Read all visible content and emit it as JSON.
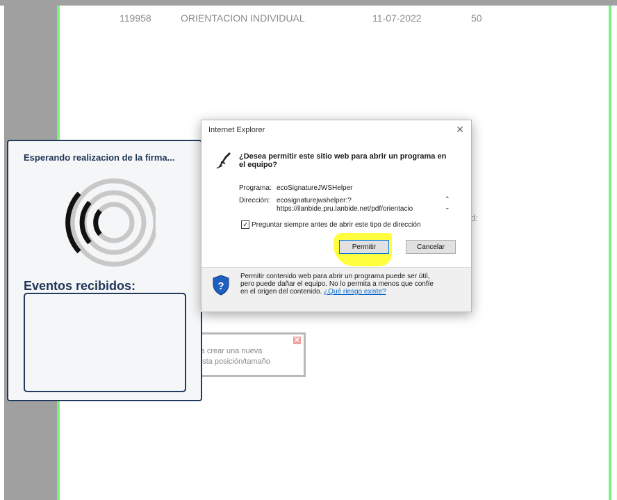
{
  "background_row": {
    "id": "119958",
    "name": "ORIENTACION INDIVIDUAL",
    "date": "11-07-2022",
    "count": "50"
  },
  "stray_text": "d:",
  "signature_popup": {
    "title": "Esperando realizacion de la firma...",
    "events_label": "Eventos recibidos:",
    "icon": "signal-waves-icon"
  },
  "hint_box": {
    "line1": "ra crear una nueva",
    "line2": "esta posición/tamaño",
    "close": "✕"
  },
  "ie_dialog": {
    "window_title": "Internet Explorer",
    "close": "✕",
    "question": "¿Desea permitir este sitio web para abrir un programa en el equipo?",
    "program_label": "Programa:",
    "program_value": "ecoSignatureJWSHelper",
    "address_label": "Dirección:",
    "address_line1": "ecosignaturejwshelper:?",
    "address_line2": "https://ilanbide.pru.lanbide.net/pdf/orientacio",
    "checkbox_label": "Preguntar siempre antes de abrir este tipo de dirección",
    "checkbox_checked": true,
    "allow_button": "Permitir",
    "cancel_button": "Cancelar",
    "warning_line1": "Permitir contenido web para abrir un programa puede ser útil,",
    "warning_line2": "pero puede dañar el equipo. No lo permita a menos que confíe",
    "warning_line3": "en el origen del contenido.",
    "risk_link": "¿Qué riesgo existe?",
    "highlight_color": "#ffff00"
  },
  "colors": {
    "page_border": "#7ff07f",
    "popup_border": "#223a5e",
    "gutter": "#a0a0a0"
  }
}
